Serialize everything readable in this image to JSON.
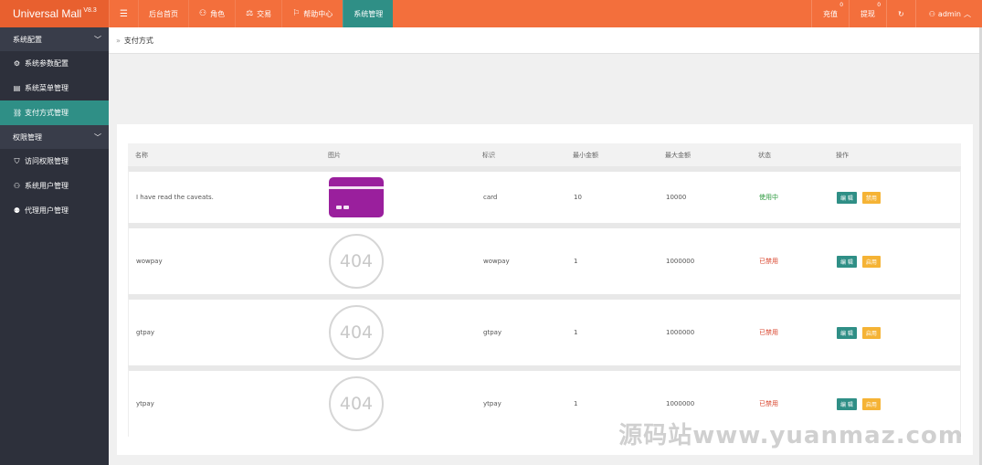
{
  "app": {
    "title": "Universal Mall",
    "version": "V8.3"
  },
  "topnav": {
    "items": [
      {
        "label": "后台首页",
        "icon": ""
      },
      {
        "label": "角色",
        "icon": "user-icon"
      },
      {
        "label": "交易",
        "icon": "balance-icon"
      },
      {
        "label": "帮助中心",
        "icon": "flag-icon"
      },
      {
        "label": "系统管理",
        "icon": ""
      }
    ],
    "right": {
      "recharge": {
        "label": "充值",
        "count": "0"
      },
      "withdraw": {
        "label": "提现",
        "count": "0"
      },
      "user": "admin"
    }
  },
  "sidebar": {
    "groups": [
      {
        "label": "系统配置",
        "items": [
          {
            "label": "系统参数配置",
            "icon": "gear-icon"
          },
          {
            "label": "系统菜单管理",
            "icon": "menu-icon"
          },
          {
            "label": "支付方式管理",
            "icon": "link-icon"
          }
        ]
      },
      {
        "label": "权限管理",
        "items": [
          {
            "label": "访问权限管理",
            "icon": "shield-icon"
          },
          {
            "label": "系统用户管理",
            "icon": "user-icon"
          },
          {
            "label": "代理用户管理",
            "icon": "users-icon"
          }
        ]
      }
    ]
  },
  "breadcrumb": {
    "current": "支付方式"
  },
  "table": {
    "headers": [
      "名称",
      "图片",
      "标识",
      "最小金额",
      "最大金额",
      "状态",
      "操作"
    ],
    "rows": [
      {
        "name": "I have read the caveats.",
        "image": "card",
        "code": "card",
        "min": "10",
        "max": "10000",
        "status": "使用中",
        "edit": "编 辑",
        "toggle": "禁用"
      },
      {
        "name": "wowpay",
        "image": "404",
        "code": "wowpay",
        "min": "1",
        "max": "1000000",
        "status": "已禁用",
        "edit": "编 辑",
        "toggle": "启用"
      },
      {
        "name": "gtpay",
        "image": "404",
        "code": "gtpay",
        "min": "1",
        "max": "1000000",
        "status": "已禁用",
        "edit": "编 辑",
        "toggle": "启用"
      },
      {
        "name": "ytpay",
        "image": "404",
        "code": "ytpay",
        "min": "1",
        "max": "1000000",
        "status": "已禁用",
        "edit": "编 辑",
        "toggle": "启用"
      }
    ]
  },
  "watermark": "源码站www.yuanmaz.com",
  "colors": {
    "topbar": "#f36f3c",
    "accent": "#2f8f86",
    "sidebar": "#2d303b",
    "warning": "#f5b335"
  }
}
